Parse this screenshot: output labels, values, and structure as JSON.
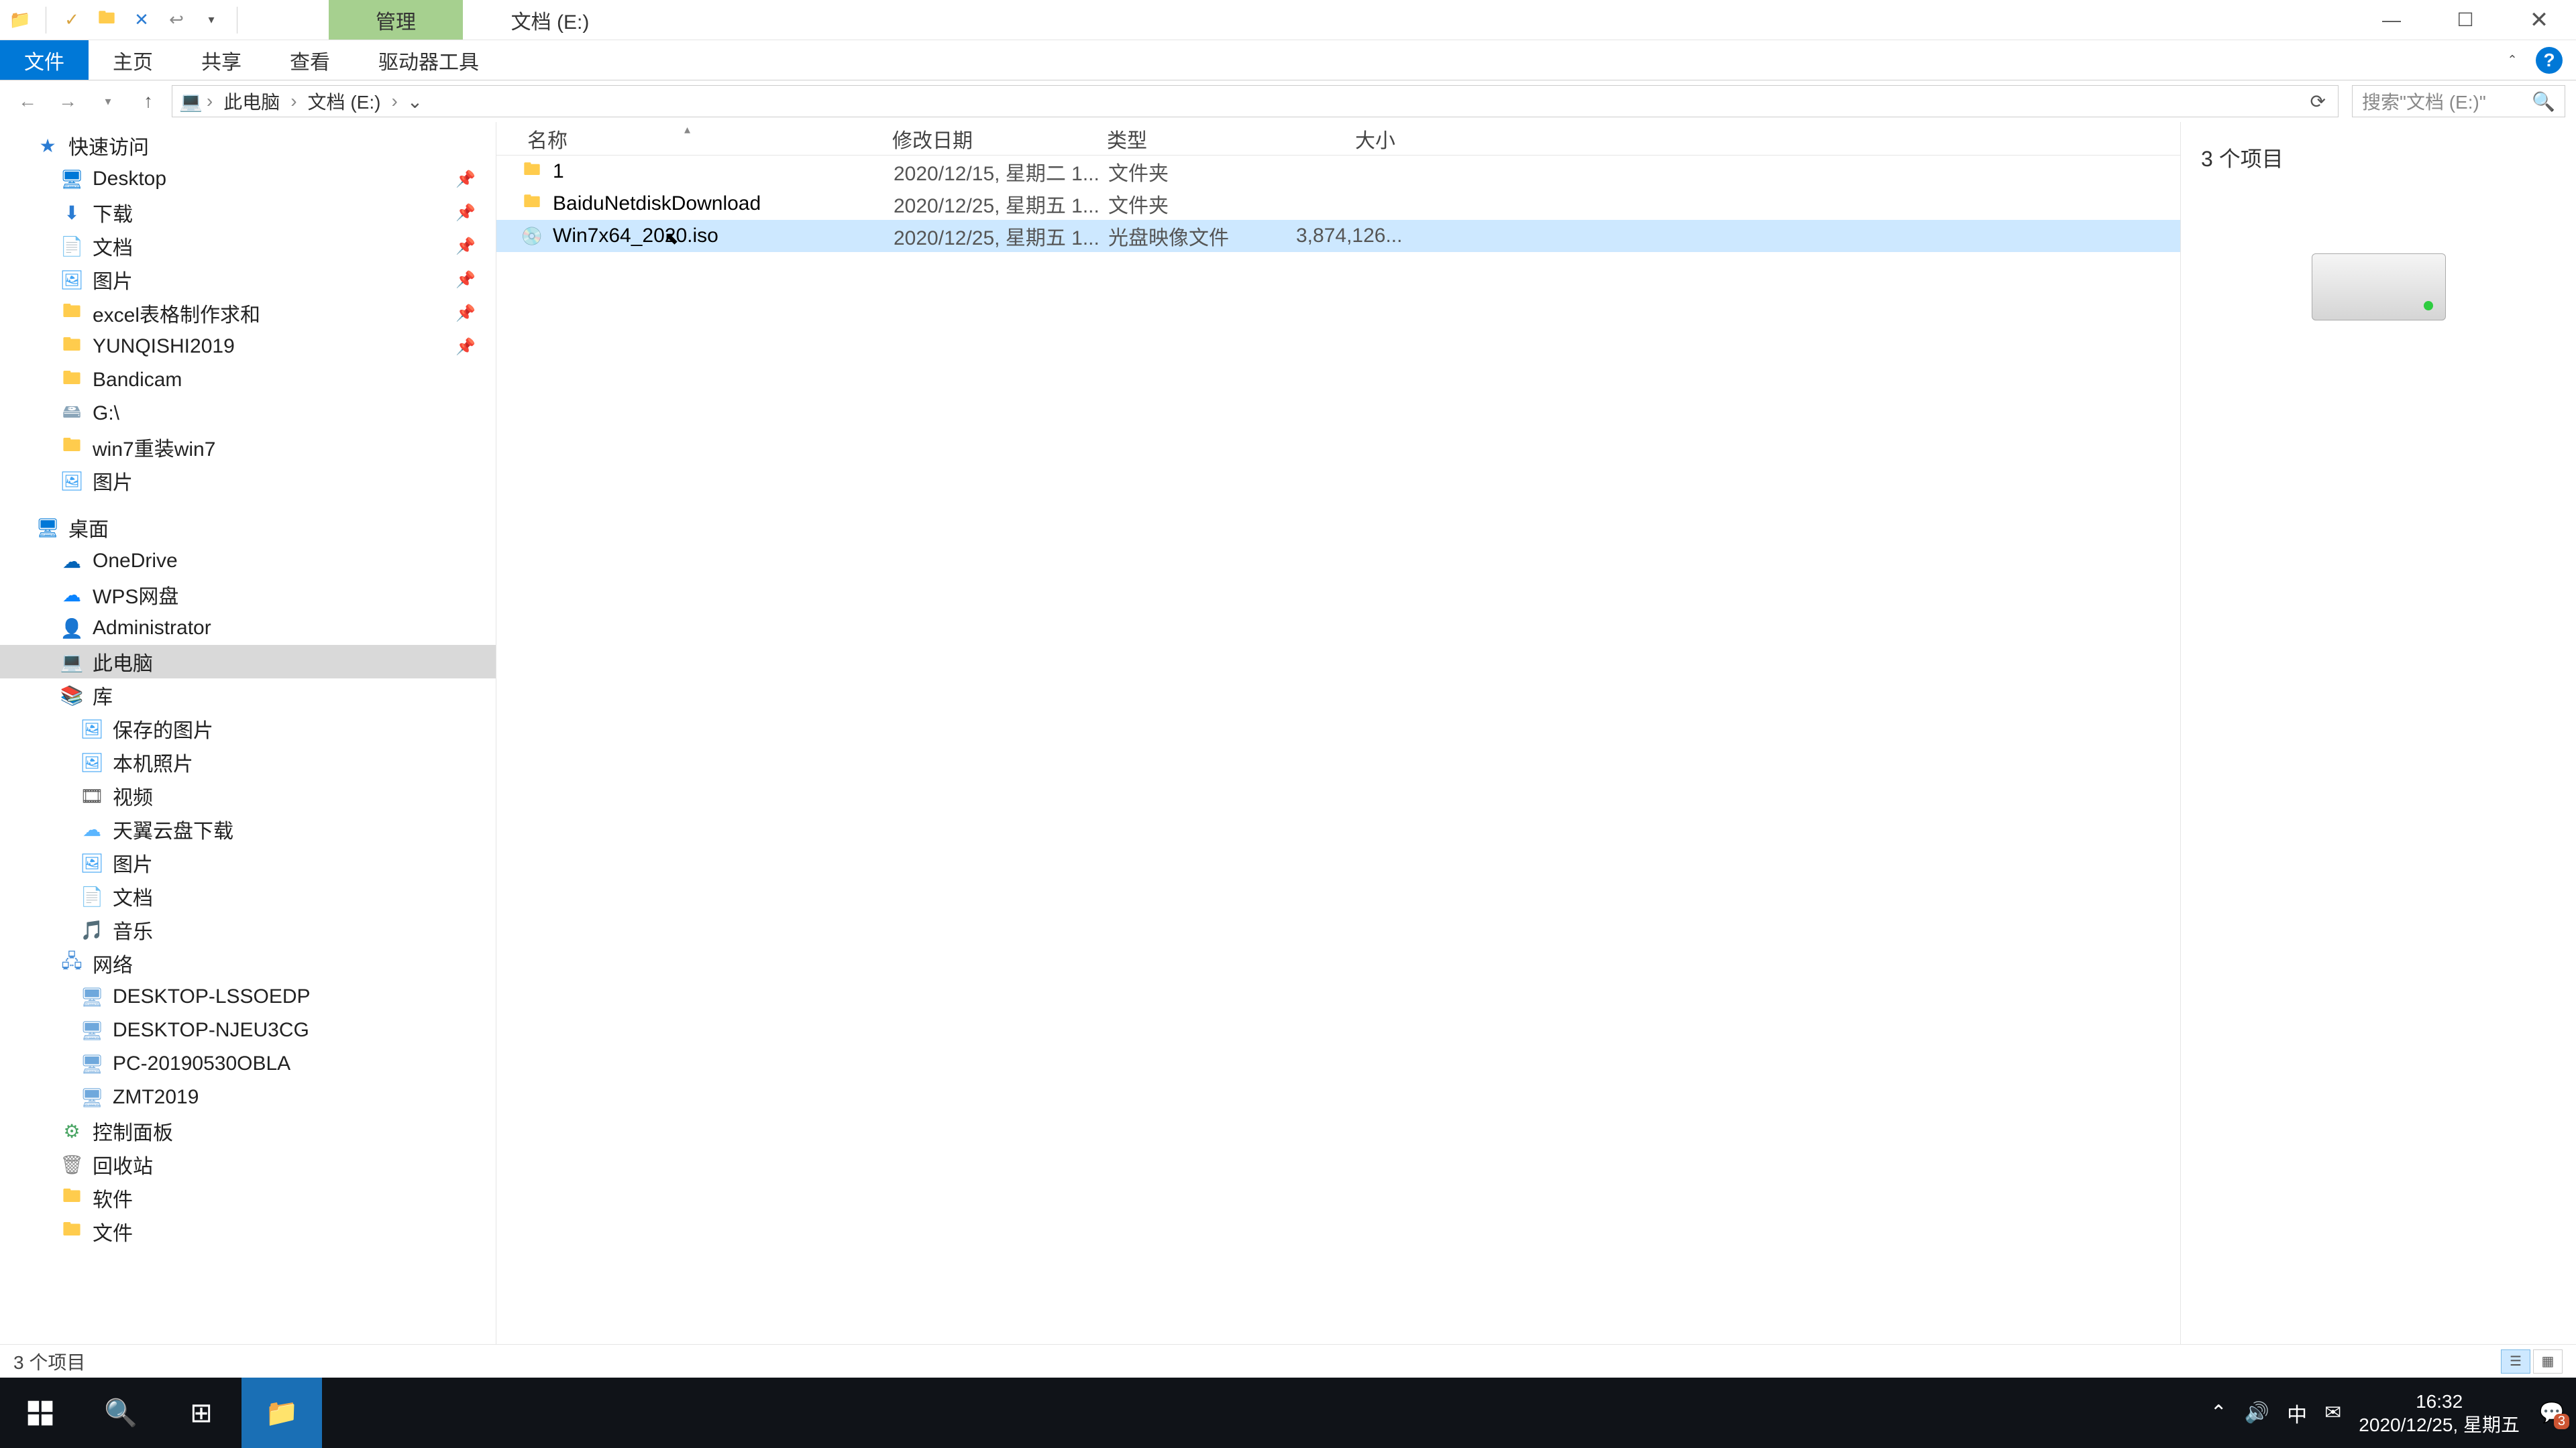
{
  "titlebar": {
    "contextual_tab": "管理",
    "title": "文档 (E:)"
  },
  "ribbon": {
    "file": "文件",
    "home": "主页",
    "share": "共享",
    "view": "查看",
    "drive_tools": "驱动器工具"
  },
  "breadcrumbs": {
    "pc": "此电脑",
    "drive": "文档 (E:)"
  },
  "search": {
    "placeholder": "搜索\"文档 (E:)\""
  },
  "sidebar": {
    "quick_access": "快速访问",
    "pins": [
      {
        "icon": "desktop",
        "label": "Desktop"
      },
      {
        "icon": "download",
        "label": "下载"
      },
      {
        "icon": "doc",
        "label": "文档"
      },
      {
        "icon": "pic",
        "label": "图片"
      },
      {
        "icon": "folder",
        "label": "excel表格制作求和"
      },
      {
        "icon": "folder",
        "label": "YUNQISHI2019"
      }
    ],
    "recents": [
      {
        "icon": "folder",
        "label": "Bandicam"
      },
      {
        "icon": "drive",
        "label": "G:\\"
      },
      {
        "icon": "folder",
        "label": "win7重装win7"
      },
      {
        "icon": "pic",
        "label": "图片"
      }
    ],
    "desktop": "桌面",
    "desktop_items": [
      {
        "icon": "onedrive",
        "label": "OneDrive"
      },
      {
        "icon": "wps",
        "label": "WPS网盘"
      },
      {
        "icon": "user",
        "label": "Administrator"
      },
      {
        "icon": "pc",
        "label": "此电脑",
        "selected": true
      },
      {
        "icon": "lib",
        "label": "库"
      }
    ],
    "libraries": [
      {
        "label": "保存的图片"
      },
      {
        "label": "本机照片"
      },
      {
        "label": "视频"
      },
      {
        "label": "天翼云盘下载"
      },
      {
        "label": "图片"
      },
      {
        "label": "文档"
      },
      {
        "label": "音乐"
      }
    ],
    "network": "网络",
    "netpcs": [
      {
        "label": "DESKTOP-LSSOEDP"
      },
      {
        "label": "DESKTOP-NJEU3CG"
      },
      {
        "label": "PC-20190530OBLA"
      },
      {
        "label": "ZMT2019"
      }
    ],
    "tail": [
      {
        "icon": "panel",
        "label": "控制面板"
      },
      {
        "icon": "trash",
        "label": "回收站"
      },
      {
        "icon": "folder",
        "label": "软件"
      },
      {
        "icon": "folder",
        "label": "文件"
      }
    ]
  },
  "columns": {
    "name": "名称",
    "date": "修改日期",
    "type": "类型",
    "size": "大小"
  },
  "files": [
    {
      "icon": "folder",
      "name": "1",
      "date": "2020/12/15, 星期二 1...",
      "type": "文件夹",
      "size": ""
    },
    {
      "icon": "folder",
      "name": "BaiduNetdiskDownload",
      "date": "2020/12/25, 星期五 1...",
      "type": "文件夹",
      "size": ""
    },
    {
      "icon": "iso",
      "name": "Win7x64_2020.iso",
      "date": "2020/12/25, 星期五 1...",
      "type": "光盘映像文件",
      "size": "3,874,126...",
      "selected": true
    }
  ],
  "details": {
    "title": "3 个项目"
  },
  "statusbar": {
    "count": "3 个项目"
  },
  "taskbar": {
    "time": "16:32",
    "date": "2020/12/25, 星期五",
    "ime": "中",
    "notif_count": "3"
  }
}
